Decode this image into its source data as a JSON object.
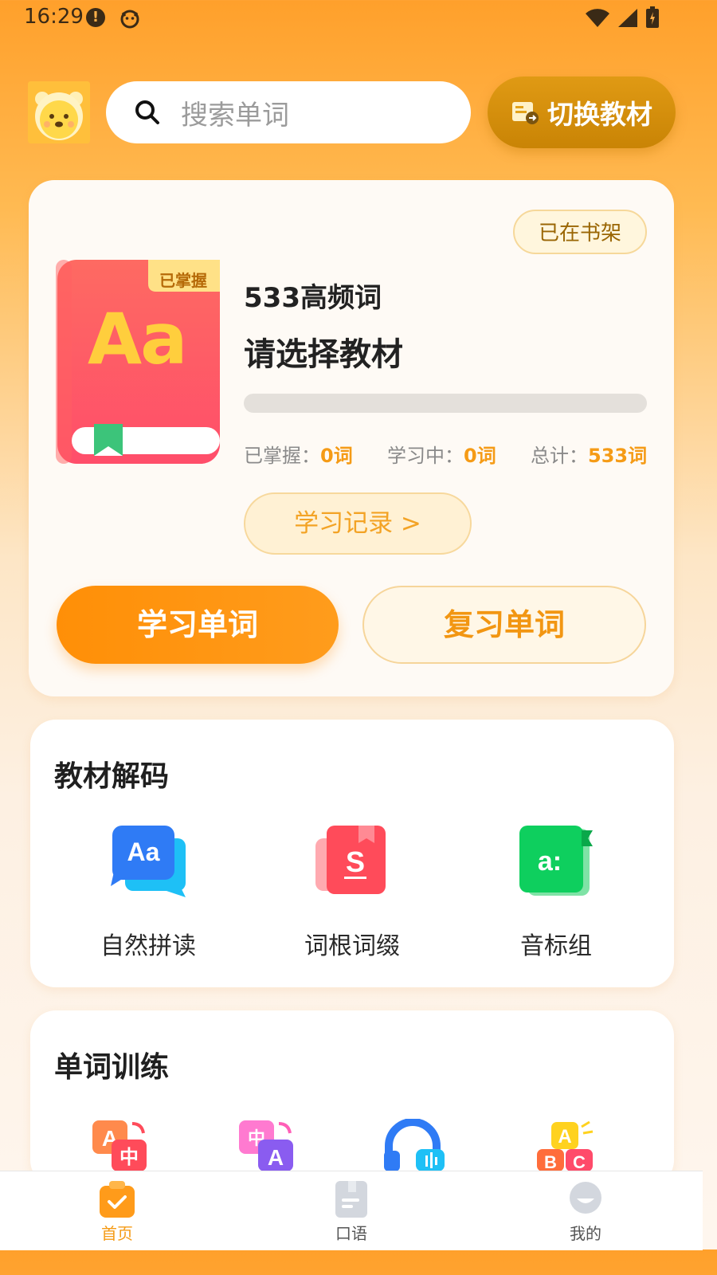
{
  "status_bar": {
    "time": "16:29"
  },
  "header": {
    "search_placeholder": "搜索单词",
    "switch_button": "切换教材"
  },
  "book_card": {
    "shelf_badge": "已在书架",
    "cover_badge": "已掌握",
    "cover_letters": "Aa",
    "title": "533高频词",
    "subtitle": "请选择教材",
    "progress": 0,
    "stats": {
      "mastered_label": "已掌握：",
      "mastered_value": "0词",
      "learning_label": "学习中：",
      "learning_value": "0词",
      "total_label": "总计：",
      "total_value": "533词"
    },
    "record_button": "学习记录 >",
    "learn_button": "学习单词",
    "review_button": "复习单词"
  },
  "decode_section": {
    "title": "教材解码",
    "items": [
      {
        "label": "自然拼读",
        "icon": "phonics-icon"
      },
      {
        "label": "词根词缀",
        "icon": "word-root-icon"
      },
      {
        "label": "音标组",
        "icon": "phonetic-icon"
      }
    ]
  },
  "training_section": {
    "title": "单词训练",
    "items": [
      {
        "icon": "en-to-cn-icon"
      },
      {
        "icon": "cn-to-en-icon"
      },
      {
        "icon": "listening-icon"
      },
      {
        "icon": "spelling-icon"
      }
    ]
  },
  "bottom_nav": {
    "items": [
      {
        "label": "首页",
        "active": true
      },
      {
        "label": "口语",
        "active": false
      },
      {
        "label": "我的",
        "active": false
      }
    ]
  },
  "colors": {
    "accent": "#ff9b1a",
    "active_nav": "#f59b16"
  }
}
